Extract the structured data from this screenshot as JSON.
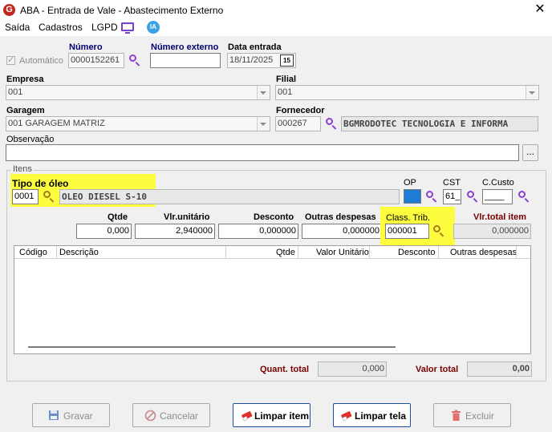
{
  "window": {
    "title": "ABA - Entrada de Vale - Abastecimento Externo",
    "logo_letter": "G",
    "close": "✕"
  },
  "menu": {
    "items": [
      "Saída",
      "Cadastros",
      "LGPD"
    ],
    "ia_label": "IA"
  },
  "header": {
    "automatico_label": "Automático",
    "numero_label": "Número",
    "numero_value": "0000152261",
    "numero_externo_label": "Número externo",
    "numero_externo_value": "",
    "data_entrada_label": "Data entrada",
    "data_entrada_value": "18/11/2025",
    "calendar_label": "15"
  },
  "empresa": {
    "label": "Empresa",
    "value": "001"
  },
  "filial": {
    "label": "Filial",
    "value": "001"
  },
  "garagem": {
    "label": "Garagem",
    "value": "001 GARAGEM MATRIZ"
  },
  "fornecedor": {
    "label": "Fornecedor",
    "code": "000267",
    "name": "BGMRODOTEC TECNOLOGIA E INFORMA"
  },
  "observacao": {
    "label": "Observação",
    "value": "",
    "button": "..."
  },
  "itens": {
    "group_label": "Itens",
    "tipo_oleo_label": "Tipo de óleo",
    "tipo_oleo_code": "0001",
    "tipo_oleo_name": "OLEO DIESEL S-10",
    "op_label": "OP",
    "cst_label": "CST",
    "cst_value": "61_",
    "ccusto_label": "C.Custo",
    "ccusto_value": "____",
    "qtde_label": "Qtde",
    "qtde_value": "0,000",
    "vlr_unit_label": "Vlr.unitário",
    "vlr_unit_value": "2,940000",
    "desconto_label": "Desconto",
    "desconto_value": "0,000000",
    "outras_label": "Outras despesas",
    "outras_value": "0,000000",
    "class_trib_label": "Class. Trib.",
    "class_trib_value": "000001",
    "vlr_total_label": "Vlr.total item",
    "vlr_total_value": "0,000000"
  },
  "grid": {
    "columns": [
      "Código",
      "Descrição",
      "Qtde",
      "Valor Unitário",
      "Desconto",
      "Outras despesas"
    ],
    "rows": []
  },
  "totals": {
    "quant_label": "Quant. total",
    "quant_value": "0,000",
    "valor_label": "Valor total",
    "valor_value": "0,00"
  },
  "buttons": {
    "gravar": "Gravar",
    "cancelar": "Cancelar",
    "limpar_item": "Limpar item",
    "limpar_tela": "Limpar tela",
    "excluir": "Excluir"
  },
  "colors": {
    "highlight": "#fdfd3f",
    "icon_purple": "#8a3fd0",
    "label_navy": "#00006e",
    "total_red": "#7a0000",
    "op_blue": "#1e7bd6"
  }
}
